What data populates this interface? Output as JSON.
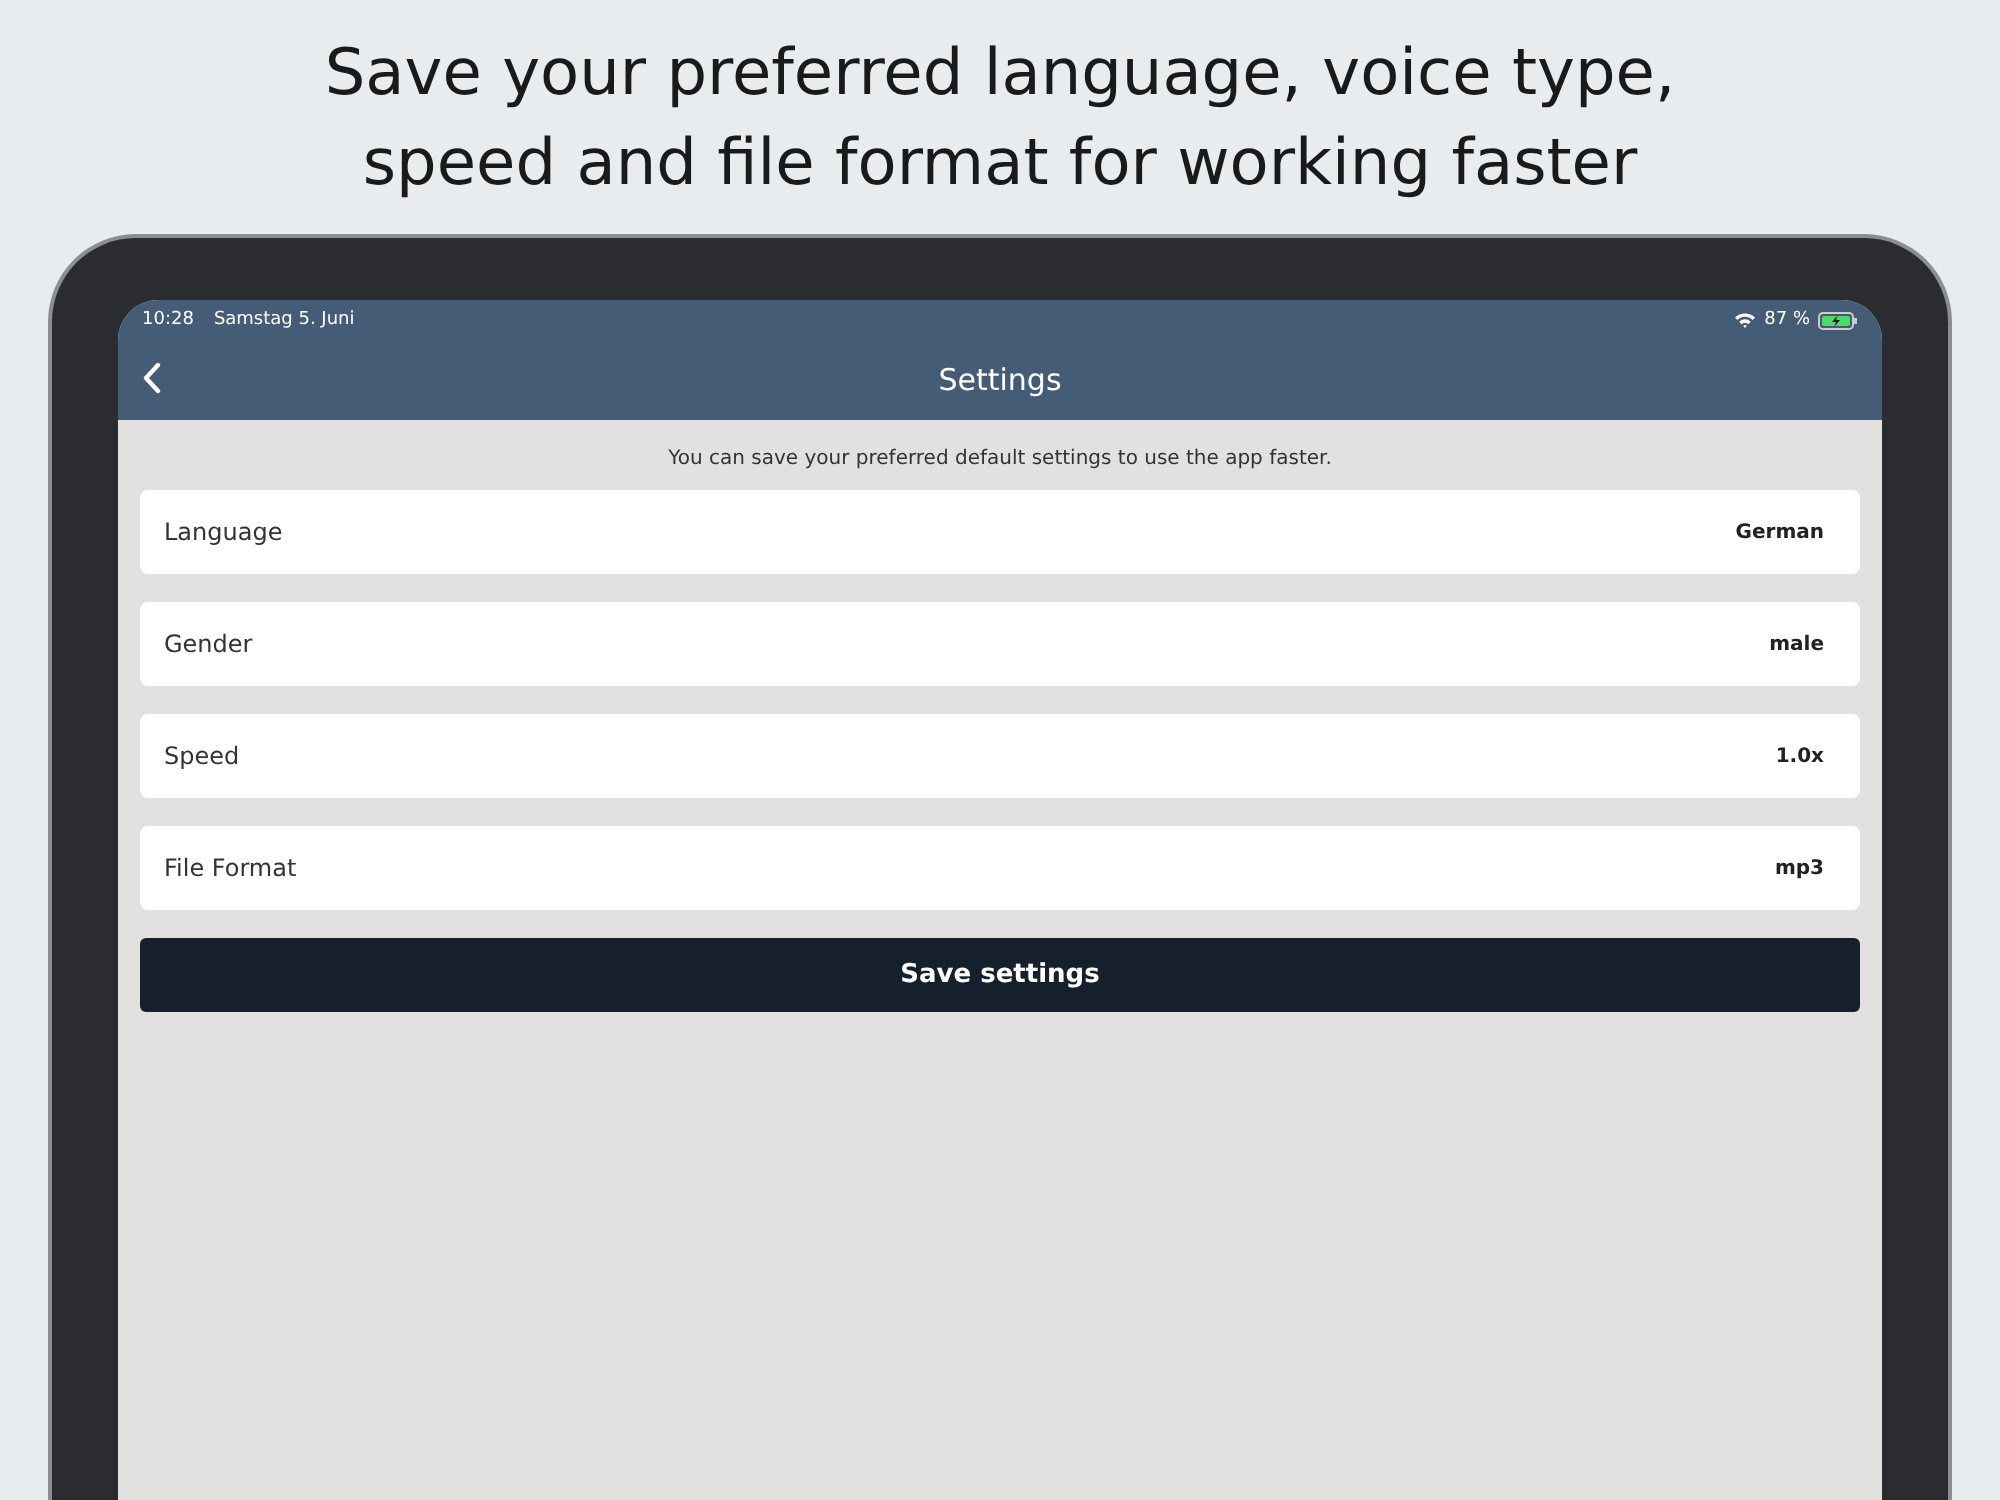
{
  "headline": "Save your preferred language, voice type, speed and file format for working faster",
  "status_bar": {
    "time": "10:28",
    "date": "Samstag 5. Juni",
    "battery": "87 %"
  },
  "nav_bar": {
    "title": "Settings"
  },
  "intro": "You can save your preferred default settings to use the app faster.",
  "settings": [
    {
      "label": "Language",
      "value": "German"
    },
    {
      "label": "Gender",
      "value": "male"
    },
    {
      "label": "Speed",
      "value": "1.0x"
    },
    {
      "label": "File Format",
      "value": "mp3"
    }
  ],
  "save_button": "Save settings"
}
